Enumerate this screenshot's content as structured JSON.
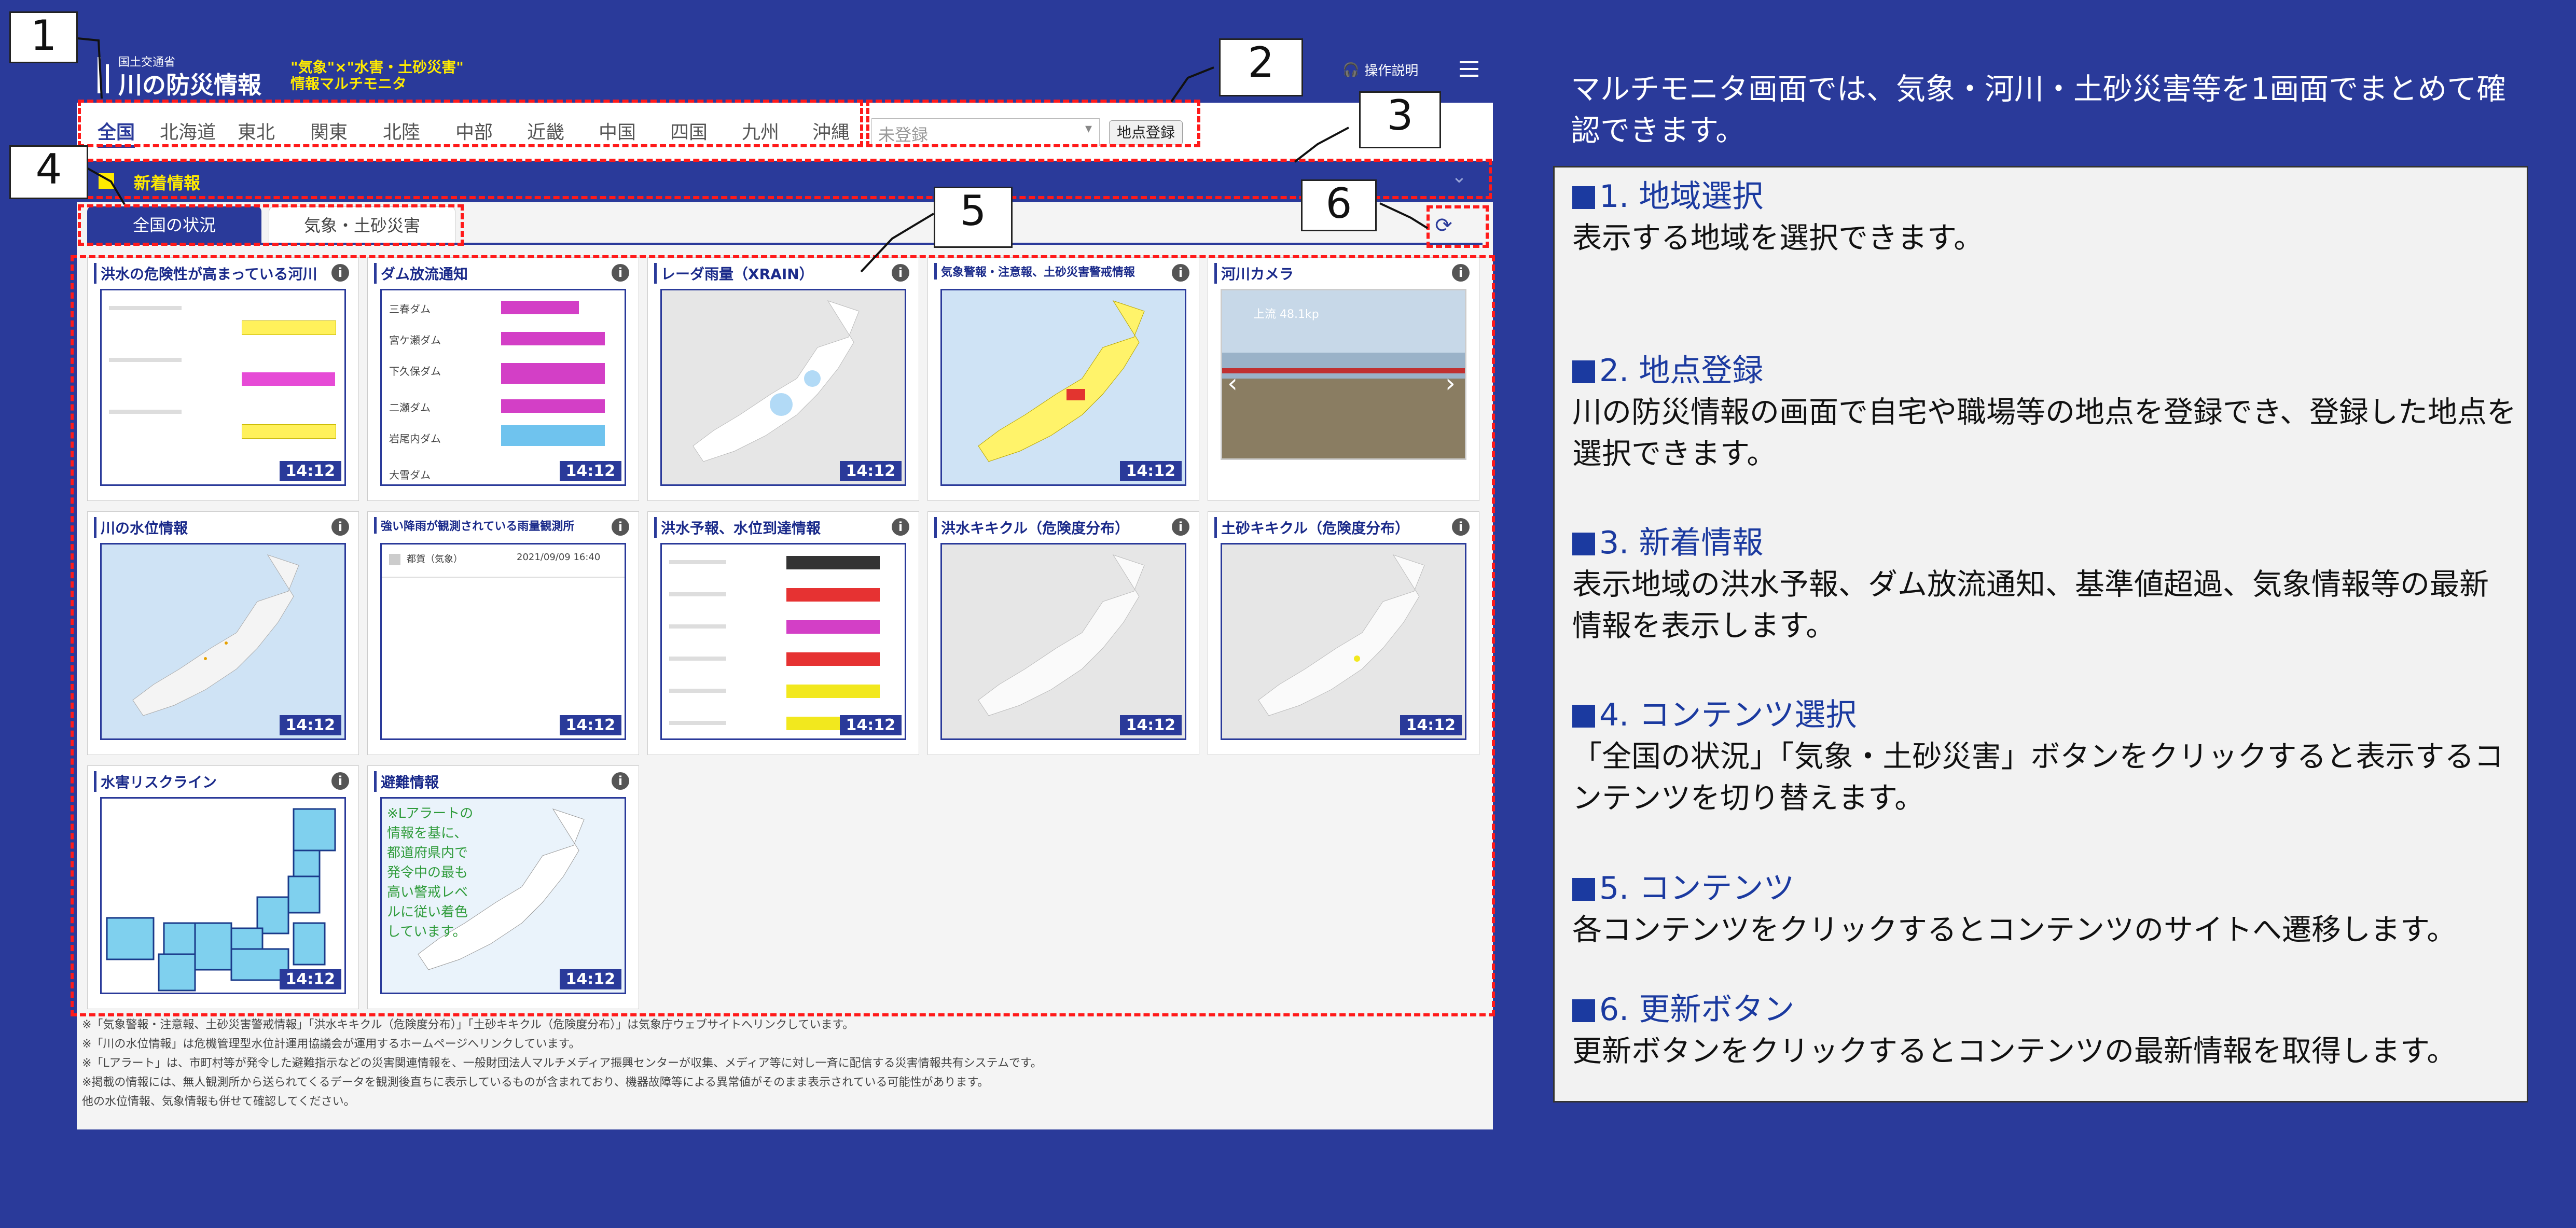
{
  "header": {
    "org": "国土交通省",
    "title": "川の防災情報",
    "tagline1": "\"気象\"×\"水害・土砂災害\"",
    "tagline2": "情報マルチモニタ",
    "help_label": "操作説明"
  },
  "nav": {
    "regions": [
      "全国",
      "北海道",
      "東北",
      "関東",
      "北陸",
      "中部",
      "近畿",
      "中国",
      "四国",
      "九州",
      "沖縄"
    ],
    "point_select_value": "未登録",
    "register_button": "地点登録"
  },
  "news": {
    "label": "新着情報"
  },
  "tabs": {
    "national": "全国の状況",
    "weather": "気象・土砂災害"
  },
  "cards": [
    {
      "title": "洪水の危険性が高まっている河川",
      "time": "14:12"
    },
    {
      "title": "ダム放流通知",
      "time": "14:12"
    },
    {
      "title": "レーダ雨量（XRAIN）",
      "time": "14:12"
    },
    {
      "title": "気象警報・注意報、土砂災害警戒情報",
      "time": "14:12"
    },
    {
      "title": "河川カメラ",
      "time": ""
    },
    {
      "title": "川の水位情報",
      "time": "14:12"
    },
    {
      "title": "強い降雨が観測されている雨量観測所",
      "time": "14:12"
    },
    {
      "title": "洪水予報、水位到達情報",
      "time": "14:12"
    },
    {
      "title": "洪水キキクル（危険度分布）",
      "time": "14:12"
    },
    {
      "title": "土砂キキクル（危険度分布）",
      "time": "14:12"
    },
    {
      "title": "水害リスクライン",
      "time": "14:12"
    },
    {
      "title": "避難情報",
      "time": "14:12"
    }
  ],
  "evac_text": "※Lアラートの情報を基に、都道府県内で発令中の最も高い警戒レベルに従い着色しています。",
  "dams": [
    "三春ダム",
    "宮ケ瀬ダム",
    "下久保ダム",
    "二瀬ダム",
    "岩尾内ダム",
    "大雪ダム"
  ],
  "camera_caption": "上流 48.1kp",
  "rain_station": {
    "name": "都賀（気象）",
    "date": "2021/09/09 16:40"
  },
  "notes": [
    "※「気象警報・注意報、土砂災害警戒情報」「洪水キキクル（危険度分布）」「土砂キキクル（危険度分布）」は気象庁ウェブサイトへリンクしています。",
    "※「川の水位情報」は危機管理型水位計運用協議会が運用するホームページへリンクしています。",
    "※「Lアラート」は、市町村等が発令した避難指示などの災害関連情報を、一般財団法人マルチメディア振興センターが収集、メディア等に対し一斉に配信する災害情報共有システムです。",
    "※掲載の情報には、無人観測所から送られてくるデータを観測後直ちに表示しているものが含まれており、機器故障等による異常値がそのまま表示されている可能性があります。",
    "他の水位情報、気象情報も併せて確認してください。"
  ],
  "callouts": [
    "1",
    "2",
    "3",
    "4",
    "5",
    "6"
  ],
  "intro": "マルチモニタ画面では、気象・河川・土砂災害等を1画面でまとめて確認できます。",
  "sections": [
    {
      "heading": "1. 地域選択",
      "body": "表示する地域を選択できます。"
    },
    {
      "heading": "2. 地点登録",
      "body": "川の防災情報の画面で自宅や職場等の地点を登録でき、登録した地点を選択できます。"
    },
    {
      "heading": "3. 新着情報",
      "body": "表示地域の洪水予報、ダム放流通知、基準値超過、気象情報等の最新情報を表示します。"
    },
    {
      "heading": "4. コンテンツ選択",
      "body": "「全国の状況」「気象・土砂災害」ボタンをクリックすると表示するコンテンツを切り替えます。"
    },
    {
      "heading": "5. コンテンツ",
      "body": "各コンテンツをクリックするとコンテンツのサイトへ遷移します。"
    },
    {
      "heading": "6. 更新ボタン",
      "body": "更新ボタンをクリックするとコンテンツの最新情報を取得します。"
    }
  ],
  "colors": {
    "bg": "#2a3a9a",
    "accent": "#ffea00",
    "dash": "#ff1a1a"
  }
}
